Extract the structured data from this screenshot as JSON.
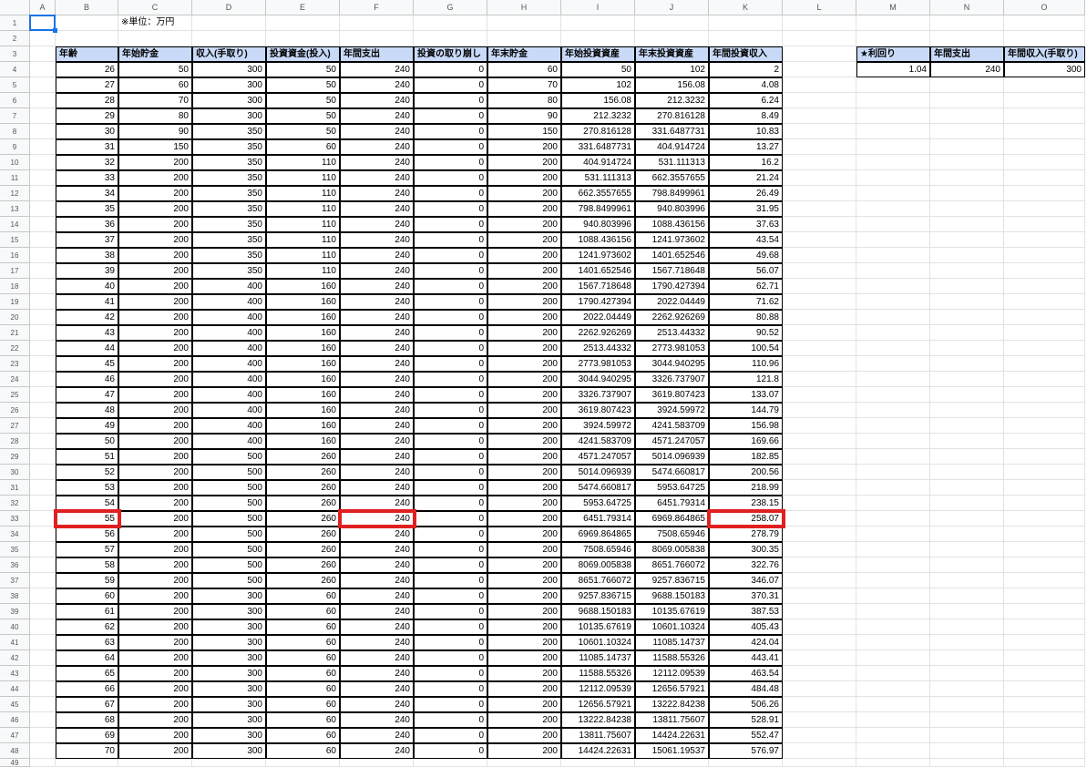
{
  "columns": [
    "A",
    "B",
    "C",
    "D",
    "E",
    "F",
    "G",
    "H",
    "I",
    "J",
    "K",
    "L",
    "M",
    "N",
    "O"
  ],
  "note": "※単位：万円",
  "table": {
    "headers": [
      "年齢",
      "年始貯金",
      "収入(手取り)",
      "投資資金(投入)",
      "年間支出",
      "投資の取り崩し",
      "年末貯金",
      "年始投資資産",
      "年末投資資産",
      "年間投資収入"
    ],
    "rows": [
      [
        "26",
        "50",
        "300",
        "50",
        "240",
        "0",
        "60",
        "50",
        "102",
        "2"
      ],
      [
        "27",
        "60",
        "300",
        "50",
        "240",
        "0",
        "70",
        "102",
        "156.08",
        "4.08"
      ],
      [
        "28",
        "70",
        "300",
        "50",
        "240",
        "0",
        "80",
        "156.08",
        "212.3232",
        "6.24"
      ],
      [
        "29",
        "80",
        "300",
        "50",
        "240",
        "0",
        "90",
        "212.3232",
        "270.816128",
        "8.49"
      ],
      [
        "30",
        "90",
        "350",
        "50",
        "240",
        "0",
        "150",
        "270.816128",
        "331.6487731",
        "10.83"
      ],
      [
        "31",
        "150",
        "350",
        "60",
        "240",
        "0",
        "200",
        "331.6487731",
        "404.914724",
        "13.27"
      ],
      [
        "32",
        "200",
        "350",
        "110",
        "240",
        "0",
        "200",
        "404.914724",
        "531.111313",
        "16.2"
      ],
      [
        "33",
        "200",
        "350",
        "110",
        "240",
        "0",
        "200",
        "531.111313",
        "662.3557655",
        "21.24"
      ],
      [
        "34",
        "200",
        "350",
        "110",
        "240",
        "0",
        "200",
        "662.3557655",
        "798.8499961",
        "26.49"
      ],
      [
        "35",
        "200",
        "350",
        "110",
        "240",
        "0",
        "200",
        "798.8499961",
        "940.803996",
        "31.95"
      ],
      [
        "36",
        "200",
        "350",
        "110",
        "240",
        "0",
        "200",
        "940.803996",
        "1088.436156",
        "37.63"
      ],
      [
        "37",
        "200",
        "350",
        "110",
        "240",
        "0",
        "200",
        "1088.436156",
        "1241.973602",
        "43.54"
      ],
      [
        "38",
        "200",
        "350",
        "110",
        "240",
        "0",
        "200",
        "1241.973602",
        "1401.652546",
        "49.68"
      ],
      [
        "39",
        "200",
        "350",
        "110",
        "240",
        "0",
        "200",
        "1401.652546",
        "1567.718648",
        "56.07"
      ],
      [
        "40",
        "200",
        "400",
        "160",
        "240",
        "0",
        "200",
        "1567.718648",
        "1790.427394",
        "62.71"
      ],
      [
        "41",
        "200",
        "400",
        "160",
        "240",
        "0",
        "200",
        "1790.427394",
        "2022.04449",
        "71.62"
      ],
      [
        "42",
        "200",
        "400",
        "160",
        "240",
        "0",
        "200",
        "2022.04449",
        "2262.926269",
        "80.88"
      ],
      [
        "43",
        "200",
        "400",
        "160",
        "240",
        "0",
        "200",
        "2262.926269",
        "2513.44332",
        "90.52"
      ],
      [
        "44",
        "200",
        "400",
        "160",
        "240",
        "0",
        "200",
        "2513.44332",
        "2773.981053",
        "100.54"
      ],
      [
        "45",
        "200",
        "400",
        "160",
        "240",
        "0",
        "200",
        "2773.981053",
        "3044.940295",
        "110.96"
      ],
      [
        "46",
        "200",
        "400",
        "160",
        "240",
        "0",
        "200",
        "3044.940295",
        "3326.737907",
        "121.8"
      ],
      [
        "47",
        "200",
        "400",
        "160",
        "240",
        "0",
        "200",
        "3326.737907",
        "3619.807423",
        "133.07"
      ],
      [
        "48",
        "200",
        "400",
        "160",
        "240",
        "0",
        "200",
        "3619.807423",
        "3924.59972",
        "144.79"
      ],
      [
        "49",
        "200",
        "400",
        "160",
        "240",
        "0",
        "200",
        "3924.59972",
        "4241.583709",
        "156.98"
      ],
      [
        "50",
        "200",
        "400",
        "160",
        "240",
        "0",
        "200",
        "4241.583709",
        "4571.247057",
        "169.66"
      ],
      [
        "51",
        "200",
        "500",
        "260",
        "240",
        "0",
        "200",
        "4571.247057",
        "5014.096939",
        "182.85"
      ],
      [
        "52",
        "200",
        "500",
        "260",
        "240",
        "0",
        "200",
        "5014.096939",
        "5474.660817",
        "200.56"
      ],
      [
        "53",
        "200",
        "500",
        "260",
        "240",
        "0",
        "200",
        "5474.660817",
        "5953.64725",
        "218.99"
      ],
      [
        "54",
        "200",
        "500",
        "260",
        "240",
        "0",
        "200",
        "5953.64725",
        "6451.79314",
        "238.15"
      ],
      [
        "55",
        "200",
        "500",
        "260",
        "240",
        "0",
        "200",
        "6451.79314",
        "6969.864865",
        "258.07"
      ],
      [
        "56",
        "200",
        "500",
        "260",
        "240",
        "0",
        "200",
        "6969.864865",
        "7508.65946",
        "278.79"
      ],
      [
        "57",
        "200",
        "500",
        "260",
        "240",
        "0",
        "200",
        "7508.65946",
        "8069.005838",
        "300.35"
      ],
      [
        "58",
        "200",
        "500",
        "260",
        "240",
        "0",
        "200",
        "8069.005838",
        "8651.766072",
        "322.76"
      ],
      [
        "59",
        "200",
        "500",
        "260",
        "240",
        "0",
        "200",
        "8651.766072",
        "9257.836715",
        "346.07"
      ],
      [
        "60",
        "200",
        "300",
        "60",
        "240",
        "0",
        "200",
        "9257.836715",
        "9688.150183",
        "370.31"
      ],
      [
        "61",
        "200",
        "300",
        "60",
        "240",
        "0",
        "200",
        "9688.150183",
        "10135.67619",
        "387.53"
      ],
      [
        "62",
        "200",
        "300",
        "60",
        "240",
        "0",
        "200",
        "10135.67619",
        "10601.10324",
        "405.43"
      ],
      [
        "63",
        "200",
        "300",
        "60",
        "240",
        "0",
        "200",
        "10601.10324",
        "11085.14737",
        "424.04"
      ],
      [
        "64",
        "200",
        "300",
        "60",
        "240",
        "0",
        "200",
        "11085.14737",
        "11588.55326",
        "443.41"
      ],
      [
        "65",
        "200",
        "300",
        "60",
        "240",
        "0",
        "200",
        "11588.55326",
        "12112.09539",
        "463.54"
      ],
      [
        "66",
        "200",
        "300",
        "60",
        "240",
        "0",
        "200",
        "12112.09539",
        "12656.57921",
        "484.48"
      ],
      [
        "67",
        "200",
        "300",
        "60",
        "240",
        "0",
        "200",
        "12656.57921",
        "13222.84238",
        "506.26"
      ],
      [
        "68",
        "200",
        "300",
        "60",
        "240",
        "0",
        "200",
        "13222.84238",
        "13811.75607",
        "528.91"
      ],
      [
        "69",
        "200",
        "300",
        "60",
        "240",
        "0",
        "200",
        "13811.75607",
        "14424.22631",
        "552.47"
      ],
      [
        "70",
        "200",
        "300",
        "60",
        "240",
        "0",
        "200",
        "14424.22631",
        "15061.19537",
        "576.97"
      ]
    ]
  },
  "params": {
    "headers": [
      "★利回り",
      "年間支出",
      "年間収入(手取り)"
    ],
    "values": [
      "1.04",
      "240",
      "300"
    ]
  },
  "colors": {
    "header_fill": "#c9daf8",
    "highlight": "#e02020",
    "selection": "#1a73e8"
  }
}
